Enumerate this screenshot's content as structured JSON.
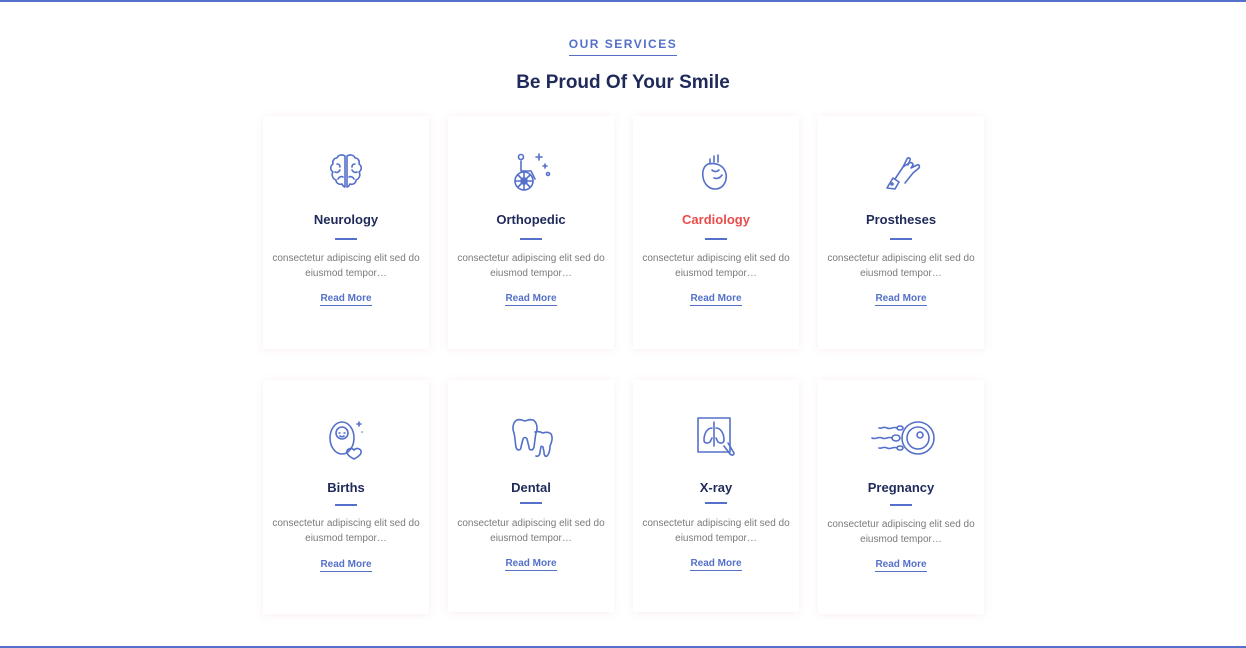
{
  "section": {
    "eyebrow": "OUR SERVICES",
    "heading": "Be Proud Of Your Smile"
  },
  "services": [
    {
      "title": "Neurology",
      "icon": "brain-icon",
      "desc": "consectetur adipiscing elit sed do eiusmod tempor…",
      "link": "Read More"
    },
    {
      "title": "Orthopedic",
      "icon": "wheelchair-icon",
      "desc": "consectetur adipiscing elit sed do eiusmod tempor…",
      "link": "Read More"
    },
    {
      "title": "Cardiology",
      "icon": "heart-icon",
      "desc": "consectetur adipiscing elit sed do eiusmod tempor…",
      "link": "Read More"
    },
    {
      "title": "Prostheses",
      "icon": "prosthetic-hand-icon",
      "desc": "consectetur adipiscing elit sed do eiusmod tempor…",
      "link": "Read More"
    },
    {
      "title": "Births",
      "icon": "baby-icon",
      "desc": "consectetur adipiscing elit sed do eiusmod tempor…",
      "link": "Read More"
    },
    {
      "title": "Dental",
      "icon": "tooth-icon",
      "desc": "consectetur adipiscing elit sed do eiusmod tempor…",
      "link": "Read More"
    },
    {
      "title": "X-ray",
      "icon": "xray-icon",
      "desc": "consectetur adipiscing elit sed do eiusmod tempor…",
      "link": "Read More"
    },
    {
      "title": "Pregnancy",
      "icon": "sperm-egg-icon",
      "desc": "consectetur adipiscing elit sed do eiusmod tempor…",
      "link": "Read More"
    }
  ],
  "colors": {
    "accent": "#5470c9",
    "heading": "#1f2a5a",
    "active": "#ec4b4b"
  }
}
